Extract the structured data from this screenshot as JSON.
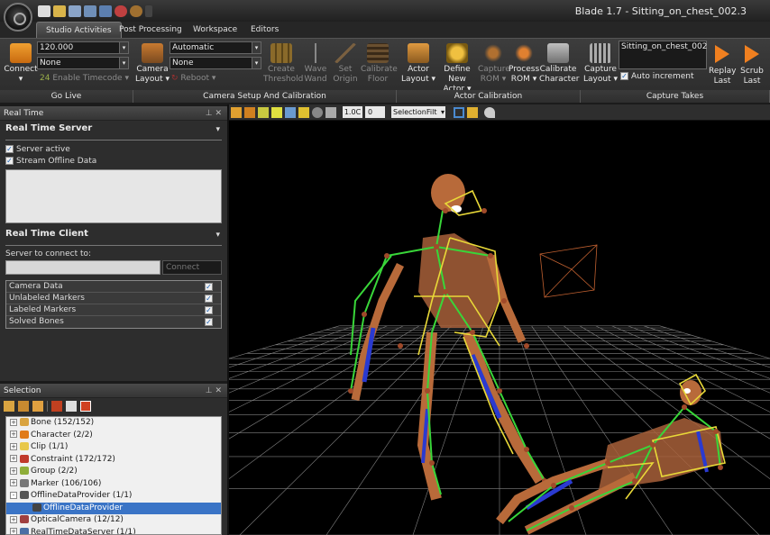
{
  "window": {
    "title": "Blade 1.7 - Sitting_on_chest_002.3"
  },
  "tabs": [
    {
      "label": "Studio Activities"
    },
    {
      "label": "Post Processing"
    },
    {
      "label": "Workspace"
    },
    {
      "label": "Editors"
    }
  ],
  "ribbon": {
    "go_live": {
      "group_label": "Go Live",
      "connect_label": "Connect",
      "rate_value": "120.000",
      "sync_value": "None",
      "enable_timecode_label": "Enable Timecode"
    },
    "camera_setup": {
      "group_label": "Camera Setup And Calibration",
      "camera_layout_line1": "Camera",
      "camera_layout_line2": "Layout",
      "mode_value": "Automatic",
      "second_value": "None",
      "reboot_label": "Reboot",
      "create_threshold": [
        "Create",
        "Threshold"
      ],
      "wave_wand": [
        "Wave",
        "Wand"
      ],
      "set_origin": [
        "Set",
        "Origin"
      ],
      "calibrate_floor": [
        "Calibrate",
        "Floor"
      ]
    },
    "actor_calibration": {
      "group_label": "Actor Calibration",
      "actor_layout": [
        "Actor",
        "Layout"
      ],
      "define_new_actor": [
        "Define New",
        "Actor"
      ],
      "capture_rom": [
        "Capture",
        "ROM"
      ],
      "process_rom": [
        "Process",
        "ROM"
      ],
      "calibrate_character": [
        "Calibrate",
        "Character"
      ]
    },
    "capture_takes": {
      "group_label": "Capture Takes",
      "capture_layout": [
        "Capture",
        "Layout"
      ],
      "take_name": "Sitting_on_chest_002",
      "auto_increment_label": "Auto increment",
      "auto_increment_checked": true,
      "replay_last": [
        "Replay",
        "Last"
      ],
      "scrub_last": [
        "Scrub",
        "Last"
      ]
    }
  },
  "realtime_panel": {
    "title": "Real Time",
    "server_heading": "Real Time Server",
    "server_active_label": "Server active",
    "stream_offline_label": "Stream Offline Data",
    "client_heading": "Real Time Client",
    "server_to_connect_label": "Server to connect to:",
    "connect_button": "Connect",
    "stream_items": [
      {
        "label": "Camera Data",
        "checked": true
      },
      {
        "label": "Unlabeled Markers",
        "checked": true
      },
      {
        "label": "Labeled Markers",
        "checked": true
      },
      {
        "label": "Solved Bones",
        "checked": true
      }
    ]
  },
  "selection_panel": {
    "title": "Selection",
    "tree": [
      {
        "label": "Bone (152/152)",
        "icon": "bone-icon",
        "color": "#d9a441",
        "expand": "+"
      },
      {
        "label": "Character (2/2)",
        "icon": "character-icon",
        "color": "#e07b1a",
        "expand": "+"
      },
      {
        "label": "Clip (1/1)",
        "icon": "clip-icon",
        "color": "#e8c84a",
        "expand": "+"
      },
      {
        "label": "Constraint (172/172)",
        "icon": "constraint-icon",
        "color": "#c0392b",
        "expand": "+"
      },
      {
        "label": "Group (2/2)",
        "icon": "group-icon",
        "color": "#8fae3a",
        "expand": "+"
      },
      {
        "label": "Marker (106/106)",
        "icon": "marker-icon",
        "color": "#777777",
        "expand": "+"
      },
      {
        "label": "OfflineDataProvider (1/1)",
        "icon": "provider-icon",
        "color": "#555555",
        "expand": "-"
      },
      {
        "label": "OfflineDataProvider",
        "icon": "provider-item-icon",
        "color": "#444444",
        "expand": "",
        "selected": true,
        "indent": true
      },
      {
        "label": "OpticalCamera (12/12)",
        "icon": "camera-icon",
        "color": "#a04040",
        "expand": "+"
      },
      {
        "label": "RealTimeDataServer (1/1)",
        "icon": "server-icon",
        "color": "#4a6fa5",
        "expand": "+"
      }
    ]
  },
  "viewport_toolbar": {
    "zoom_value": "1.0C",
    "frame_value": "0",
    "selection_filter": "SelectionFilt"
  }
}
